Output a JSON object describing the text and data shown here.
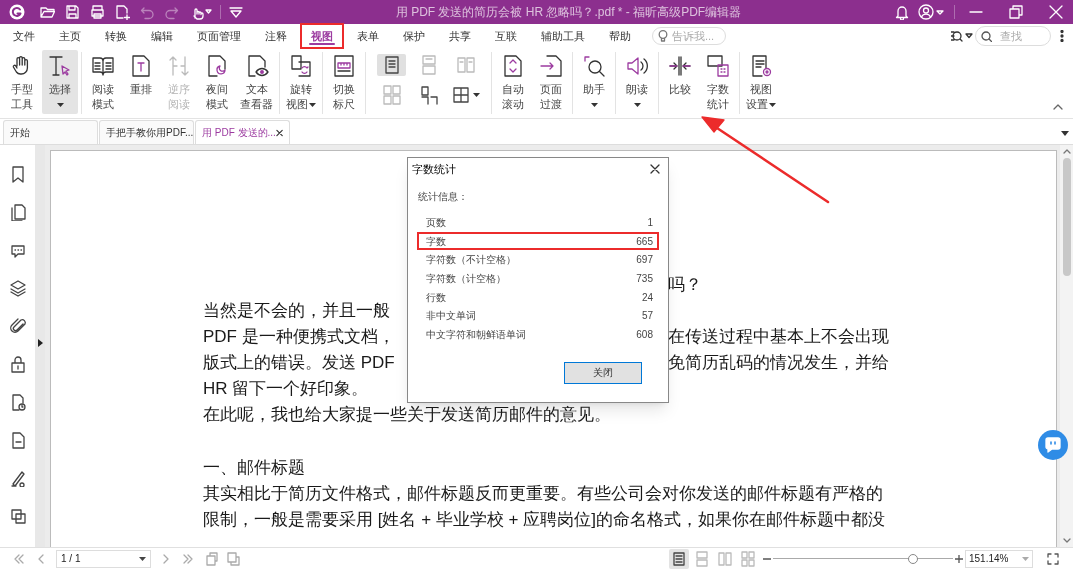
{
  "window": {
    "title": "用 PDF 发送的简历会被 HR 忽略吗？.pdf * - 福昕高级PDF编辑器"
  },
  "menu": [
    {
      "label": "文件",
      "selected": false
    },
    {
      "label": "主页",
      "selected": false
    },
    {
      "label": "转换",
      "selected": false
    },
    {
      "label": "编辑",
      "selected": false
    },
    {
      "label": "页面管理",
      "selected": false
    },
    {
      "label": "注释",
      "selected": false
    },
    {
      "label": "视图",
      "selected": true,
      "annotated": true
    },
    {
      "label": "表单",
      "selected": false
    },
    {
      "label": "保护",
      "selected": false
    },
    {
      "label": "共享",
      "selected": false
    },
    {
      "label": "互联",
      "selected": false
    },
    {
      "label": "辅助工具",
      "selected": false
    },
    {
      "label": "帮助",
      "selected": false
    }
  ],
  "tell_me": {
    "placeholder": "告诉我..."
  },
  "search": {
    "placeholder": "查找"
  },
  "ribbon": [
    [
      {
        "kind": "large",
        "lines": [
          "手型",
          "工具"
        ],
        "selected": false,
        "disabled": false
      },
      {
        "kind": "large",
        "lines": [
          "选择"
        ],
        "selected": true,
        "disabled": false,
        "dropdown": true
      }
    ],
    [
      {
        "kind": "large",
        "lines": [
          "阅读",
          "模式"
        ],
        "selected": false,
        "disabled": false
      },
      {
        "kind": "large",
        "lines": [
          "重排"
        ],
        "selected": false,
        "disabled": false
      },
      {
        "kind": "large",
        "lines": [
          "逆序",
          "阅读"
        ],
        "selected": false,
        "disabled": true
      },
      {
        "kind": "large",
        "lines": [
          "夜间",
          "模式"
        ],
        "selected": false,
        "disabled": false
      },
      {
        "kind": "large",
        "lines": [
          "文本",
          "查看器"
        ],
        "selected": false,
        "disabled": false
      }
    ],
    [
      {
        "kind": "large",
        "lines": [
          "旋转",
          "视图"
        ],
        "selected": false,
        "disabled": false,
        "dropdown": true
      }
    ],
    [
      {
        "kind": "large",
        "lines": [
          "切换",
          "标尺"
        ],
        "selected": false,
        "disabled": false
      }
    ],
    [
      {
        "kind": "grid",
        "buttons": [
          {
            "selected": true,
            "disabled": false
          },
          {
            "selected": false,
            "disabled": true
          },
          {
            "selected": false,
            "disabled": true
          },
          {
            "selected": false,
            "disabled": true
          },
          {
            "selected": false,
            "disabled": false
          },
          {
            "selected": false,
            "disabled": false,
            "dropdown": true
          }
        ]
      }
    ],
    [
      {
        "kind": "large",
        "lines": [
          "自动",
          "滚动"
        ],
        "selected": false,
        "disabled": false
      },
      {
        "kind": "large",
        "lines": [
          "页面",
          "过渡"
        ],
        "selected": false,
        "disabled": false
      }
    ],
    [
      {
        "kind": "large",
        "lines": [
          "助手"
        ],
        "selected": false,
        "disabled": false,
        "dropdown": true
      }
    ],
    [
      {
        "kind": "large",
        "lines": [
          "朗读"
        ],
        "selected": false,
        "disabled": false,
        "dropdown": true
      }
    ],
    [
      {
        "kind": "large",
        "lines": [
          "比较"
        ],
        "selected": false,
        "disabled": false
      },
      {
        "kind": "large",
        "lines": [
          "字数",
          "统计"
        ],
        "selected": false,
        "disabled": false,
        "annotated": true
      }
    ],
    [
      {
        "kind": "large",
        "lines": [
          "视图",
          "设置"
        ],
        "selected": false,
        "disabled": false,
        "dropdown": true
      }
    ]
  ],
  "doc_tabs": [
    {
      "label": "开始",
      "selected": false
    },
    {
      "label": "手把手教你用PDF...",
      "selected": false
    },
    {
      "label": "用 PDF 发送的...",
      "selected": true
    }
  ],
  "document": {
    "lines": [
      {
        "kind": "text",
        "right": "吗？"
      },
      {
        "kind": "text",
        "left": "当然是不会的，并且一般"
      },
      {
        "kind": "text",
        "left": "PDF 是一种便携式文档，",
        "right": "在传送过程中基本上不会出现"
      },
      {
        "kind": "text",
        "left": "版式上的错误。发送 PDF",
        "right": "免简历乱码的情况发生，并给"
      },
      {
        "kind": "text",
        "left": "HR 留下一个好印象。"
      },
      {
        "kind": "text",
        "left": "在此呢，我也给大家提一些关于发送简历邮件的意见。"
      },
      {
        "kind": "heading",
        "left": "一、邮件标题"
      },
      {
        "kind": "text",
        "left": "其实相比于简历文件格式，邮件标题反而更重要。有些公司会对你发送的邮件标题有严格的"
      },
      {
        "kind": "text",
        "left": "限制，一般是需要采用 [姓名 + 毕业学校 + 应聘岗位]的命名格式，如果你在邮件标题中都没"
      }
    ]
  },
  "dialog": {
    "title": "字数统计",
    "section": "统计信息：",
    "rows": [
      {
        "label": "页数",
        "value": "1",
        "annotated": false
      },
      {
        "label": "字数",
        "value": "665",
        "annotated": true
      },
      {
        "label": "字符数（不计空格）",
        "value": "697",
        "annotated": false
      },
      {
        "label": "字符数（计空格）",
        "value": "735",
        "annotated": false
      },
      {
        "label": "行数",
        "value": "24",
        "annotated": false
      },
      {
        "label": "非中文单词",
        "value": "57",
        "annotated": false
      },
      {
        "label": "中文字符和朝鲜语单词",
        "value": "608",
        "annotated": false
      }
    ],
    "button": "关闭"
  },
  "status": {
    "page": "1 / 1",
    "views": [
      {
        "selected": true
      },
      {
        "selected": false
      },
      {
        "selected": false
      },
      {
        "selected": false
      }
    ],
    "zoom": {
      "level": 0.78,
      "value": "151.14%"
    }
  }
}
